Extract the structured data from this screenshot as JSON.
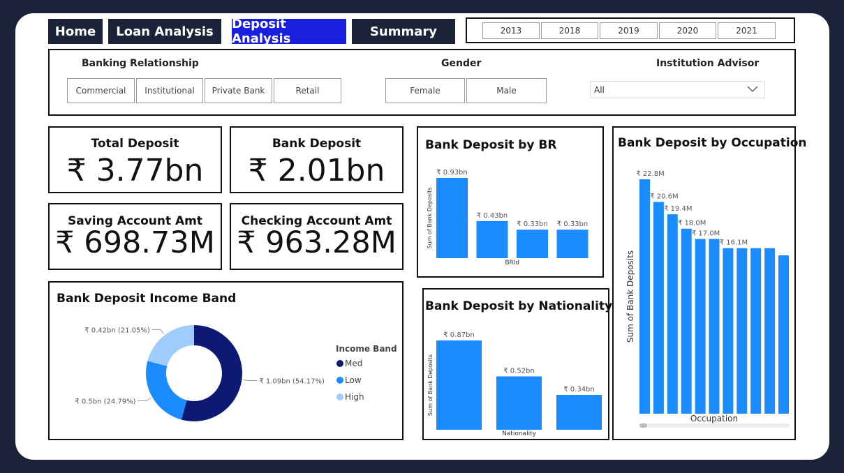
{
  "nav": {
    "home": "Home",
    "loan": "Loan Analysis",
    "deposit": "Deposit Analysis",
    "summary": "Summary"
  },
  "years": [
    "2013",
    "2018",
    "2019",
    "2020",
    "2021"
  ],
  "filters": {
    "banking_title": "Banking Relationship",
    "banking_options": [
      "Commercial",
      "Institutional",
      "Private Bank",
      "Retail"
    ],
    "gender_title": "Gender",
    "gender_options": [
      "Female",
      "Male"
    ],
    "advisor_title": "Institution Advisor",
    "advisor_value": "All"
  },
  "kpis": {
    "total_deposit": {
      "label": "Total Deposit",
      "value": "₹ 3.77bn"
    },
    "bank_deposit": {
      "label": "Bank Deposit",
      "value": "₹ 2.01bn"
    },
    "saving_amt": {
      "label": "Saving Account Amt",
      "value": "₹ 698.73M"
    },
    "checking_amt": {
      "label": "Checking Account Amt",
      "value": "₹ 963.28M"
    }
  },
  "colors": {
    "bar": "#1a8cff",
    "med": "#0d1a73",
    "low": "#1a8cff",
    "high": "#9fcdfb",
    "nav_bg": "#1b2338",
    "nav_active": "#1a1fdb"
  },
  "chart_data": [
    {
      "type": "bar",
      "title": "Bank Deposit by BR",
      "xlabel": "BRId",
      "ylabel": "Sum of Bank Deposits",
      "categories": [
        "",
        "",
        "",
        ""
      ],
      "values": [
        0.93,
        0.43,
        0.33,
        0.33
      ],
      "labels": [
        "₹ 0.93bn",
        "₹ 0.43bn",
        "₹ 0.33bn",
        "₹ 0.33bn"
      ],
      "ylim": [
        0,
        0.93
      ]
    },
    {
      "type": "bar",
      "title": "Bank Deposit by Nationality",
      "xlabel": "Nationality",
      "ylabel": "Sum of Bank Deposits",
      "categories": [
        "",
        "",
        ""
      ],
      "values": [
        0.87,
        0.52,
        0.34
      ],
      "labels": [
        "₹ 0.87bn",
        "₹ 0.52bn",
        "₹ 0.34bn"
      ],
      "ylim": [
        0,
        0.87
      ]
    },
    {
      "type": "bar",
      "title": "Bank Deposit by Occupation",
      "xlabel": "Occupation",
      "ylabel": "Sum of Bank Deposits",
      "categories": [
        "",
        "",
        "",
        "",
        "",
        "",
        "",
        "",
        "",
        "",
        ""
      ],
      "values": [
        22.8,
        20.6,
        19.4,
        18.0,
        17.0,
        17.0,
        16.1,
        16.1,
        16.1,
        16.1,
        15.4
      ],
      "labels": [
        "₹ 22.8M",
        "₹ 20.6M",
        "₹ 19.4M",
        "₹ 18.0M",
        "₹ 17.0M",
        "",
        "₹ 16.1M",
        "",
        "",
        "",
        ""
      ],
      "ylim": [
        0,
        22.8
      ]
    },
    {
      "type": "pie",
      "title": "Bank Deposit Income Band",
      "legend_title": "Income Band",
      "slices": [
        {
          "name": "Med",
          "value": 1.09,
          "label": "₹ 1.09bn (54.17%)"
        },
        {
          "name": "Low",
          "value": 0.5,
          "label": "₹ 0.5bn (24.79%)"
        },
        {
          "name": "High",
          "value": 0.42,
          "label": "₹ 0.42bn (21.05%)"
        }
      ]
    }
  ]
}
